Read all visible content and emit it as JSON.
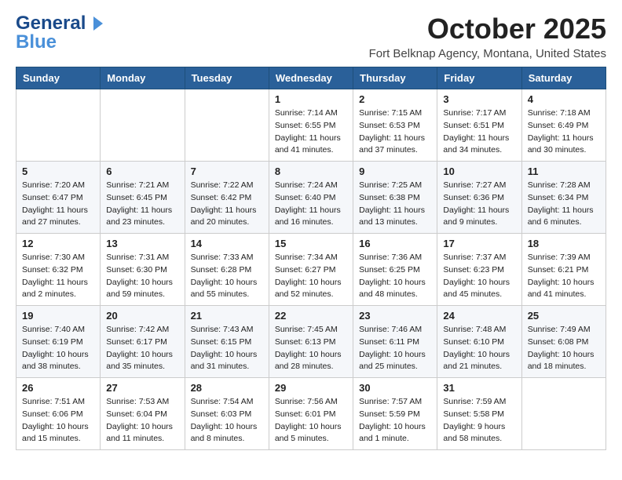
{
  "logo": {
    "line1": "General",
    "line2": "Blue",
    "icon": "▶"
  },
  "title": "October 2025",
  "location": "Fort Belknap Agency, Montana, United States",
  "days_of_week": [
    "Sunday",
    "Monday",
    "Tuesday",
    "Wednesday",
    "Thursday",
    "Friday",
    "Saturday"
  ],
  "weeks": [
    [
      {
        "day": "",
        "info": ""
      },
      {
        "day": "",
        "info": ""
      },
      {
        "day": "",
        "info": ""
      },
      {
        "day": "1",
        "info": "Sunrise: 7:14 AM\nSunset: 6:55 PM\nDaylight: 11 hours\nand 41 minutes."
      },
      {
        "day": "2",
        "info": "Sunrise: 7:15 AM\nSunset: 6:53 PM\nDaylight: 11 hours\nand 37 minutes."
      },
      {
        "day": "3",
        "info": "Sunrise: 7:17 AM\nSunset: 6:51 PM\nDaylight: 11 hours\nand 34 minutes."
      },
      {
        "day": "4",
        "info": "Sunrise: 7:18 AM\nSunset: 6:49 PM\nDaylight: 11 hours\nand 30 minutes."
      }
    ],
    [
      {
        "day": "5",
        "info": "Sunrise: 7:20 AM\nSunset: 6:47 PM\nDaylight: 11 hours\nand 27 minutes."
      },
      {
        "day": "6",
        "info": "Sunrise: 7:21 AM\nSunset: 6:45 PM\nDaylight: 11 hours\nand 23 minutes."
      },
      {
        "day": "7",
        "info": "Sunrise: 7:22 AM\nSunset: 6:42 PM\nDaylight: 11 hours\nand 20 minutes."
      },
      {
        "day": "8",
        "info": "Sunrise: 7:24 AM\nSunset: 6:40 PM\nDaylight: 11 hours\nand 16 minutes."
      },
      {
        "day": "9",
        "info": "Sunrise: 7:25 AM\nSunset: 6:38 PM\nDaylight: 11 hours\nand 13 minutes."
      },
      {
        "day": "10",
        "info": "Sunrise: 7:27 AM\nSunset: 6:36 PM\nDaylight: 11 hours\nand 9 minutes."
      },
      {
        "day": "11",
        "info": "Sunrise: 7:28 AM\nSunset: 6:34 PM\nDaylight: 11 hours\nand 6 minutes."
      }
    ],
    [
      {
        "day": "12",
        "info": "Sunrise: 7:30 AM\nSunset: 6:32 PM\nDaylight: 11 hours\nand 2 minutes."
      },
      {
        "day": "13",
        "info": "Sunrise: 7:31 AM\nSunset: 6:30 PM\nDaylight: 10 hours\nand 59 minutes."
      },
      {
        "day": "14",
        "info": "Sunrise: 7:33 AM\nSunset: 6:28 PM\nDaylight: 10 hours\nand 55 minutes."
      },
      {
        "day": "15",
        "info": "Sunrise: 7:34 AM\nSunset: 6:27 PM\nDaylight: 10 hours\nand 52 minutes."
      },
      {
        "day": "16",
        "info": "Sunrise: 7:36 AM\nSunset: 6:25 PM\nDaylight: 10 hours\nand 48 minutes."
      },
      {
        "day": "17",
        "info": "Sunrise: 7:37 AM\nSunset: 6:23 PM\nDaylight: 10 hours\nand 45 minutes."
      },
      {
        "day": "18",
        "info": "Sunrise: 7:39 AM\nSunset: 6:21 PM\nDaylight: 10 hours\nand 41 minutes."
      }
    ],
    [
      {
        "day": "19",
        "info": "Sunrise: 7:40 AM\nSunset: 6:19 PM\nDaylight: 10 hours\nand 38 minutes."
      },
      {
        "day": "20",
        "info": "Sunrise: 7:42 AM\nSunset: 6:17 PM\nDaylight: 10 hours\nand 35 minutes."
      },
      {
        "day": "21",
        "info": "Sunrise: 7:43 AM\nSunset: 6:15 PM\nDaylight: 10 hours\nand 31 minutes."
      },
      {
        "day": "22",
        "info": "Sunrise: 7:45 AM\nSunset: 6:13 PM\nDaylight: 10 hours\nand 28 minutes."
      },
      {
        "day": "23",
        "info": "Sunrise: 7:46 AM\nSunset: 6:11 PM\nDaylight: 10 hours\nand 25 minutes."
      },
      {
        "day": "24",
        "info": "Sunrise: 7:48 AM\nSunset: 6:10 PM\nDaylight: 10 hours\nand 21 minutes."
      },
      {
        "day": "25",
        "info": "Sunrise: 7:49 AM\nSunset: 6:08 PM\nDaylight: 10 hours\nand 18 minutes."
      }
    ],
    [
      {
        "day": "26",
        "info": "Sunrise: 7:51 AM\nSunset: 6:06 PM\nDaylight: 10 hours\nand 15 minutes."
      },
      {
        "day": "27",
        "info": "Sunrise: 7:53 AM\nSunset: 6:04 PM\nDaylight: 10 hours\nand 11 minutes."
      },
      {
        "day": "28",
        "info": "Sunrise: 7:54 AM\nSunset: 6:03 PM\nDaylight: 10 hours\nand 8 minutes."
      },
      {
        "day": "29",
        "info": "Sunrise: 7:56 AM\nSunset: 6:01 PM\nDaylight: 10 hours\nand 5 minutes."
      },
      {
        "day": "30",
        "info": "Sunrise: 7:57 AM\nSunset: 5:59 PM\nDaylight: 10 hours\nand 1 minute."
      },
      {
        "day": "31",
        "info": "Sunrise: 7:59 AM\nSunset: 5:58 PM\nDaylight: 9 hours\nand 58 minutes."
      },
      {
        "day": "",
        "info": ""
      }
    ]
  ]
}
